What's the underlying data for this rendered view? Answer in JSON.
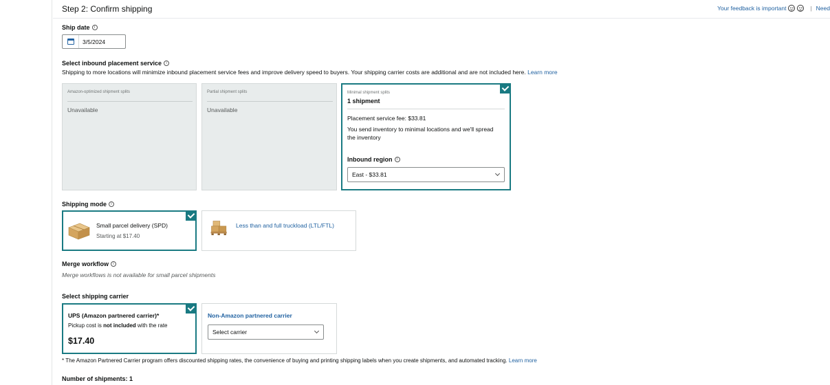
{
  "header": {
    "step_title": "Step 2: Confirm shipping",
    "feedback_text": "Your feedback is important",
    "separator": "|",
    "need_help": "Need"
  },
  "ship_date": {
    "label": "Ship date",
    "value": "3/5/2024"
  },
  "placement": {
    "label": "Select inbound placement service",
    "description": "Shipping to more locations will minimize inbound placement service fees and improve delivery speed to buyers. Your shipping carrier costs are additional and are not included here.",
    "learn_more": "Learn more",
    "options": [
      {
        "title": "Amazon-optimized shipment splits",
        "status": "Unavailable"
      },
      {
        "title": "Partial shipment splits",
        "status": "Unavailable"
      },
      {
        "title": "Minimal shipment splits",
        "count": "1 shipment",
        "fee": "Placement service fee: $33.81",
        "explanation": "You send inventory to minimal locations and we'll spread the inventory",
        "region_label": "Inbound region",
        "region_value": "East - $33.81"
      }
    ]
  },
  "shipping_mode": {
    "label": "Shipping mode",
    "options": [
      {
        "title": "Small parcel delivery (SPD)",
        "subtitle": "Starting at $17.40"
      },
      {
        "title": "Less than and full truckload (LTL/FTL)"
      }
    ]
  },
  "merge": {
    "label": "Merge workflow",
    "note": "Merge workflows is not available for small parcel shipments"
  },
  "carrier": {
    "label": "Select shipping carrier",
    "ups": {
      "title": "UPS (Amazon partnered carrier)*",
      "sub_before": "Pickup cost is ",
      "sub_bold": "not included",
      "sub_after": " with the rate",
      "price": "$17.40"
    },
    "non_amazon": {
      "title": "Non-Amazon partnered carrier",
      "select_placeholder": "Select carrier"
    },
    "footnote": "* The Amazon Partnered Carrier program offers discounted shipping rates, the convenience of buying and printing shipping labels when you create shipments, and automated tracking.",
    "footnote_link": "Learn more"
  },
  "num_shipments": "Number of shipments: 1",
  "icons": {
    "info": "i",
    "accent_color": "#197a82",
    "link_color": "#2162a1"
  }
}
